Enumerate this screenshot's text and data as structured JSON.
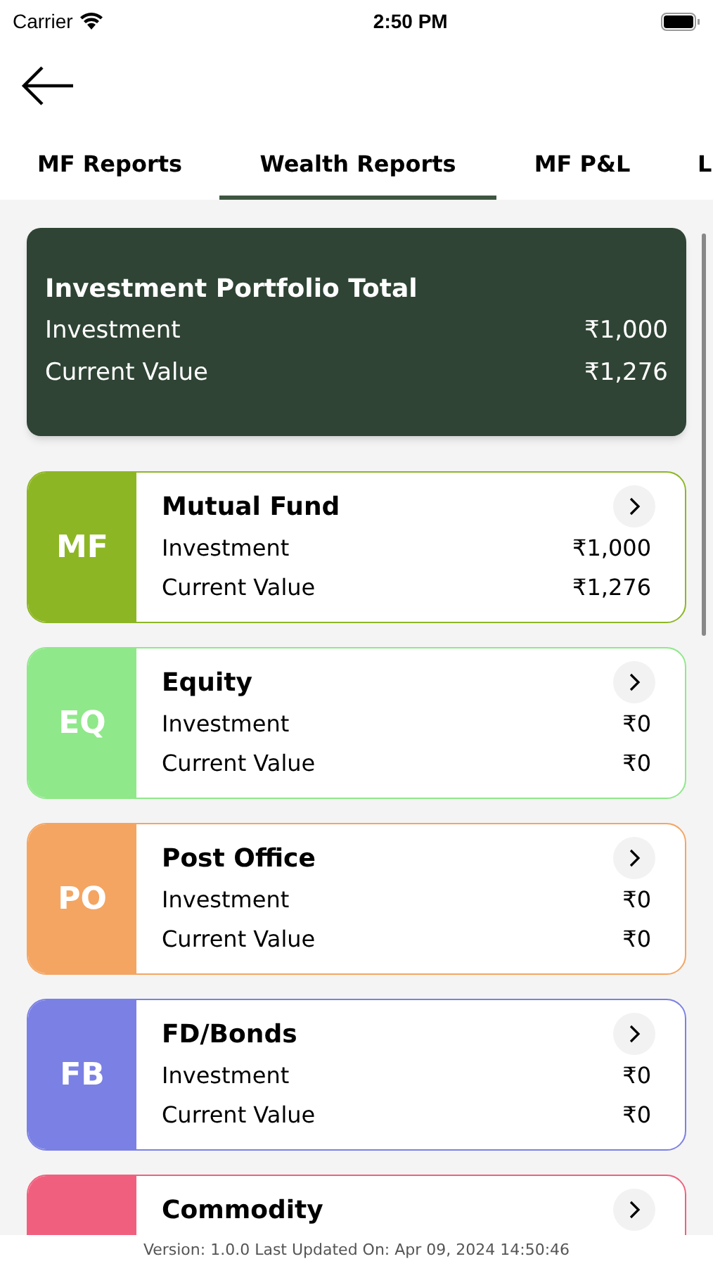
{
  "status_bar": {
    "carrier": "Carrier",
    "time": "2:50 PM"
  },
  "tabs": [
    {
      "label": "MF Reports",
      "selected": false
    },
    {
      "label": "Wealth Reports",
      "selected": true
    },
    {
      "label": "MF P&L",
      "selected": false
    },
    {
      "label": "L",
      "selected": false
    }
  ],
  "total": {
    "title": "Investment Portfolio Total",
    "rows": [
      {
        "label": "Investment",
        "value": "₹1,000"
      },
      {
        "label": "Current Value",
        "value": "₹1,276"
      }
    ]
  },
  "categories": [
    {
      "code": "MF",
      "name": "Mutual Fund",
      "color": "#8db625",
      "rows": [
        {
          "label": "Investment",
          "value": "₹1,000"
        },
        {
          "label": "Current Value",
          "value": "₹1,276"
        }
      ]
    },
    {
      "code": "EQ",
      "name": "Equity",
      "color": "#8fe88a",
      "rows": [
        {
          "label": "Investment",
          "value": "₹0"
        },
        {
          "label": "Current Value",
          "value": "₹0"
        }
      ]
    },
    {
      "code": "PO",
      "name": "Post Office",
      "color": "#f4a562",
      "rows": [
        {
          "label": "Investment",
          "value": "₹0"
        },
        {
          "label": "Current Value",
          "value": "₹0"
        }
      ]
    },
    {
      "code": "FB",
      "name": "FD/Bonds",
      "color": "#7b80e4",
      "rows": [
        {
          "label": "Investment",
          "value": "₹0"
        },
        {
          "label": "Current Value",
          "value": "₹0"
        }
      ]
    },
    {
      "name": "Commodity",
      "color": "#f0607e"
    }
  ],
  "footer": "Version: 1.0.0 Last Updated On: Apr 09, 2024 14:50:46"
}
